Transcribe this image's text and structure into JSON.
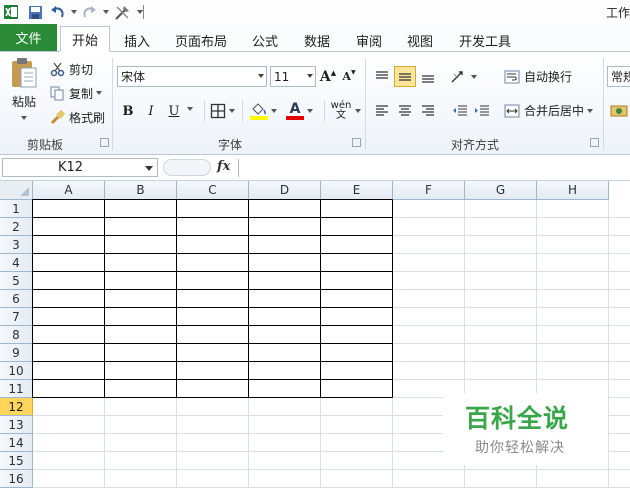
{
  "titlebar": {
    "title": "工作",
    "quick_access": [
      "excel-logo-icon",
      "save-icon",
      "undo-icon",
      "redo-icon",
      "customize-tools-icon"
    ]
  },
  "ribbon_tabs": [
    {
      "label": "文件"
    },
    {
      "label": "开始"
    },
    {
      "label": "插入"
    },
    {
      "label": "页面布局"
    },
    {
      "label": "公式"
    },
    {
      "label": "数据"
    },
    {
      "label": "审阅"
    },
    {
      "label": "视图"
    },
    {
      "label": "开发工具"
    }
  ],
  "active_tab": "开始",
  "clipboard": {
    "paste": "粘贴",
    "cut": "剪切",
    "copy": "复制",
    "format_painter": "格式刷",
    "group_label": "剪贴板"
  },
  "font": {
    "name": "宋体",
    "size": "11",
    "group_label": "字体",
    "bold": "B",
    "italic": "I",
    "underline": "U",
    "grow": "A",
    "shrink": "A",
    "font_color_letter": "A",
    "font_color": "#e00000",
    "fill_color": "#ffff00",
    "phonetic": "wén 文"
  },
  "alignment": {
    "wrap_text": "自动换行",
    "merge_center": "合并后居中",
    "group_label": "对齐方式"
  },
  "number": {
    "format": "常规"
  },
  "formula_bar": {
    "name_box": "K12",
    "fx_label": "fx",
    "content": ""
  },
  "columns": [
    "A",
    "B",
    "C",
    "D",
    "E",
    "F",
    "G",
    "H"
  ],
  "rows": [
    "1",
    "2",
    "3",
    "4",
    "5",
    "6",
    "7",
    "8",
    "9",
    "10",
    "11",
    "12",
    "13",
    "14",
    "15",
    "16"
  ],
  "selected_row": "12",
  "bordered_range": {
    "from_col": "A",
    "to_col": "E",
    "from_row": "1",
    "to_row": "11"
  },
  "watermark": {
    "title": "百科全说",
    "subtitle": "助你轻松解决"
  },
  "colors": {
    "file_tab": "#2a8a36",
    "selected_row_header": "#ffd55c",
    "watermark_green": "#3aa64a"
  }
}
